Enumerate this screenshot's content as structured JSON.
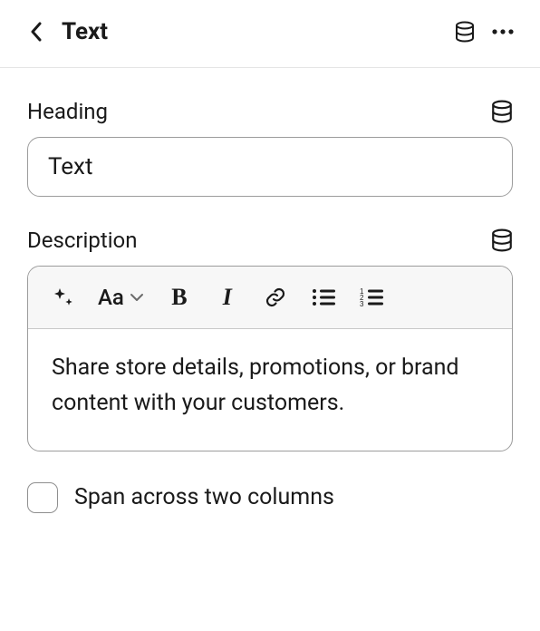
{
  "header": {
    "title": "Text"
  },
  "heading": {
    "label": "Heading",
    "value": "Text"
  },
  "description": {
    "label": "Description",
    "toolbar": {
      "para_label": "Aa"
    },
    "body": "Share store details, promotions, or brand content with your customers."
  },
  "span": {
    "label": "Span across two columns"
  }
}
